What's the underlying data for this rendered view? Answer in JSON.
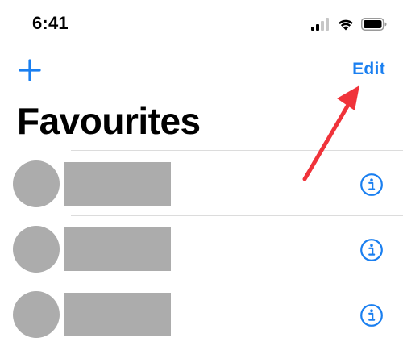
{
  "status_bar": {
    "time": "6:41",
    "icons": [
      "cellular-signal-icon",
      "wifi-icon",
      "battery-icon"
    ]
  },
  "nav": {
    "add_icon": "plus-icon",
    "edit_label": "Edit"
  },
  "page": {
    "title": "Favourites"
  },
  "favourites": [
    {
      "avatar": "redacted-avatar",
      "name": "",
      "info_icon": "info-icon"
    },
    {
      "avatar": "redacted-avatar",
      "name": "",
      "info_icon": "info-icon"
    },
    {
      "avatar": "redacted-avatar",
      "name": "",
      "info_icon": "info-icon"
    }
  ],
  "annotation": {
    "arrow_color": "#f0333a",
    "points_to": "edit-button"
  },
  "colors": {
    "accent": "#1a7ff0",
    "redaction": "#acacac",
    "divider": "#dcdcdc",
    "text": "#000000",
    "background": "#ffffff",
    "annotation": "#f0333a"
  }
}
